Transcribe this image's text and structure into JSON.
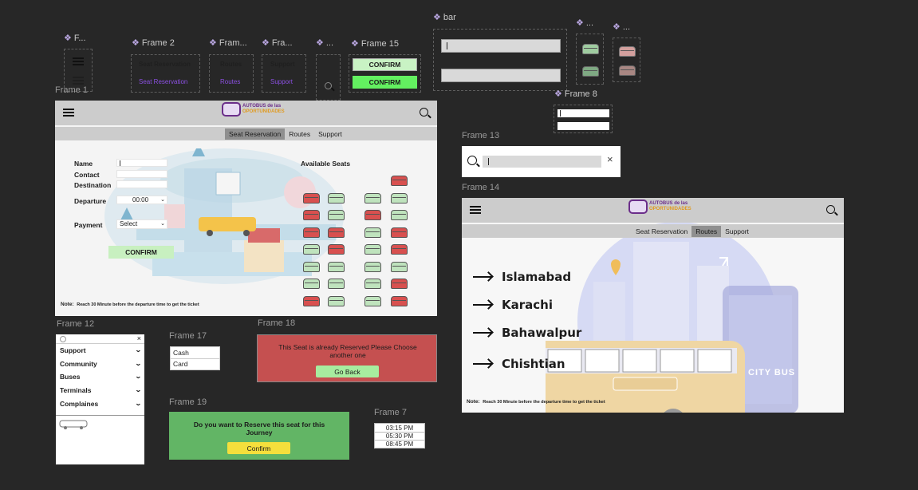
{
  "components": {
    "f_label": "F...",
    "frame2_label": "Frame 2",
    "fram_label": "Fram...",
    "fra_label": "Fra...",
    "dots_label": "...",
    "frame15_label": "Frame 15",
    "bar_label": "bar",
    "dots2_label": "...",
    "dots3_label": "...",
    "frame8_label": "Frame 8",
    "nav_seat": "Seat Reservation",
    "nav_seat_active": "Seat Reservation",
    "nav_routes": "Routes",
    "nav_routes_active": "Routes",
    "nav_support": "Support",
    "nav_support_active": "Support",
    "confirm1": "CONFIRM",
    "confirm2": "CONFIRM"
  },
  "frame1": {
    "label": "Frame 1",
    "logo_line1": "AUTOBUS de las",
    "logo_line2": "OPORTUNIDADES",
    "tabs": [
      "Seat Reservation",
      "Routes",
      "Support"
    ],
    "active_tab": "Seat Reservation",
    "form": {
      "name_label": "Name",
      "contact_label": "Contact",
      "destination_label": "Destination",
      "departure_label": "Departure",
      "departure_value": "00:00",
      "payment_label": "Payment",
      "payment_value": "Select",
      "confirm": "CONFIRM"
    },
    "available_seats_title": "Available Seats",
    "note_label": "Note:",
    "note_text": "Reach 30 Minute before the departure time to get the ticket"
  },
  "frame12": {
    "label": "Frame 12",
    "items": [
      "Support",
      "Community",
      "Buses",
      "Terminals",
      "Complaines"
    ]
  },
  "frame17": {
    "label": "Frame 17",
    "options": [
      "Cash",
      "Card"
    ]
  },
  "frame18": {
    "label": "Frame 18",
    "message": "This Seat is already Reserved Please Choose another one",
    "button": "Go Back",
    "bg": "#c55050"
  },
  "frame19": {
    "label": "Frame 19",
    "message": "Do you want to Reserve this seat for this Journey",
    "button": "Confirm",
    "bg": "#62b565"
  },
  "frame7": {
    "label": "Frame 7",
    "times": [
      "03:15 PM",
      "05:30 PM",
      "08:45 PM"
    ]
  },
  "frame13": {
    "label": "Frame 13"
  },
  "frame14": {
    "label": "Frame 14",
    "logo_line1": "AUTOBUS de las",
    "logo_line2": "OPORTUNIDADES",
    "tabs": [
      "Seat Reservation",
      "Routes",
      "Support"
    ],
    "active_tab": "Routes",
    "routes": [
      "Islamabad",
      "Karachi",
      "Bahawalpur",
      "Chishtian"
    ],
    "city_bus_text": "CITY BUS",
    "note_label": "Note:",
    "note_text": "Reach 30 Minute before the departure time to get the ticket"
  },
  "colors": {
    "seat_reserved": "#d8504f",
    "seat_free": "#bfe3bd",
    "confirm_green": "#63f060",
    "accent_purple": "#8a4fe0"
  },
  "seats": {
    "columns": [
      [
        "",
        "r",
        "r",
        "r",
        "g",
        "g",
        "g",
        "r"
      ],
      [
        "",
        "g",
        "g",
        "r",
        "r",
        "g",
        "g",
        "g"
      ],
      [
        "",
        "g",
        "r",
        "g",
        "g",
        "g",
        "g",
        "g"
      ],
      [
        "r",
        "g",
        "g",
        "r",
        "r",
        "g",
        "r",
        "r"
      ]
    ]
  }
}
